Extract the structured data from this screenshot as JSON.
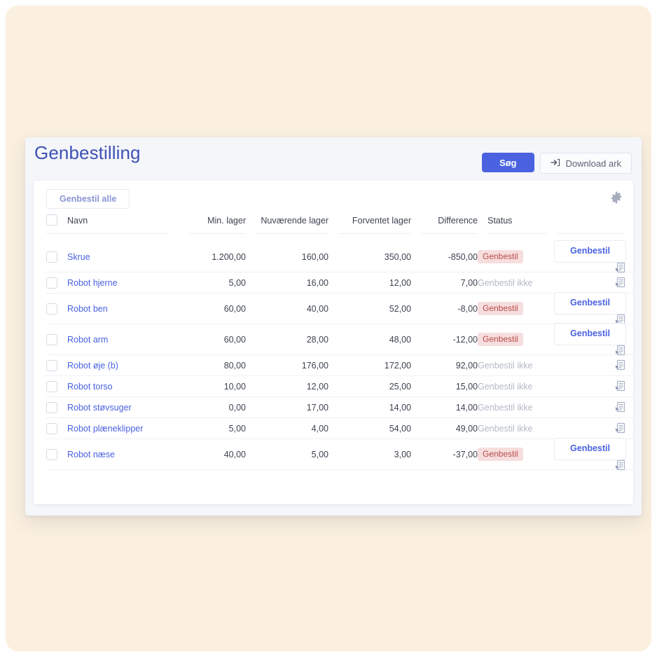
{
  "page": {
    "title": "Genbestilling",
    "background_color": "#fbf0df",
    "accent_color": "#4a62e0"
  },
  "header": {
    "search_label": "Søg",
    "download_label": "Download ark",
    "download_icon": "import-arrow-icon"
  },
  "toolbar": {
    "reorder_all_label": "Genbestil alle",
    "settings_icon": "gear-icon"
  },
  "table": {
    "columns": [
      {
        "key": "check",
        "label": ""
      },
      {
        "key": "name",
        "label": "Navn"
      },
      {
        "key": "min",
        "label": "Min. lager"
      },
      {
        "key": "current",
        "label": "Nuværende lager"
      },
      {
        "key": "expected",
        "label": "Forventet lager"
      },
      {
        "key": "diff",
        "label": "Difference"
      },
      {
        "key": "status",
        "label": "Status"
      },
      {
        "key": "action",
        "label": ""
      }
    ],
    "status_badge_label": "Genbestil",
    "status_muted_label": "Genbestil ikke",
    "row_action_label": "Genbestil",
    "note_icon": "note-document-icon",
    "rows": [
      {
        "name": "Skrue",
        "min": "1.200,00",
        "current": "160,00",
        "expected": "350,00",
        "diff": "-850,00",
        "status": "Genbestil",
        "status_type": "badge",
        "has_action_button": true
      },
      {
        "name": "Robot hjerne",
        "min": "5,00",
        "current": "16,00",
        "expected": "12,00",
        "diff": "7,00",
        "status": "Genbestil ikke",
        "status_type": "muted",
        "has_action_button": false
      },
      {
        "name": "Robot ben",
        "min": "60,00",
        "current": "40,00",
        "expected": "52,00",
        "diff": "-8,00",
        "status": "Genbestil",
        "status_type": "badge",
        "has_action_button": true
      },
      {
        "name": "Robot arm",
        "min": "60,00",
        "current": "28,00",
        "expected": "48,00",
        "diff": "-12,00",
        "status": "Genbestil",
        "status_type": "badge",
        "has_action_button": true
      },
      {
        "name": "Robot øje (b)",
        "min": "80,00",
        "current": "176,00",
        "expected": "172,00",
        "diff": "92,00",
        "status": "Genbestil ikke",
        "status_type": "muted",
        "has_action_button": false
      },
      {
        "name": "Robot torso",
        "min": "10,00",
        "current": "12,00",
        "expected": "25,00",
        "diff": "15,00",
        "status": "Genbestil ikke",
        "status_type": "muted",
        "has_action_button": false
      },
      {
        "name": "Robot støvsuger",
        "min": "0,00",
        "current": "17,00",
        "expected": "14,00",
        "diff": "14,00",
        "status": "Genbestil ikke",
        "status_type": "muted",
        "has_action_button": false
      },
      {
        "name": "Robot plæneklipper",
        "min": "5,00",
        "current": "4,00",
        "expected": "54,00",
        "diff": "49,00",
        "status": "Genbestil ikke",
        "status_type": "muted",
        "has_action_button": false
      },
      {
        "name": "Robot næse",
        "min": "40,00",
        "current": "5,00",
        "expected": "3,00",
        "diff": "-37,00",
        "status": "Genbestil",
        "status_type": "badge",
        "has_action_button": true
      }
    ]
  }
}
